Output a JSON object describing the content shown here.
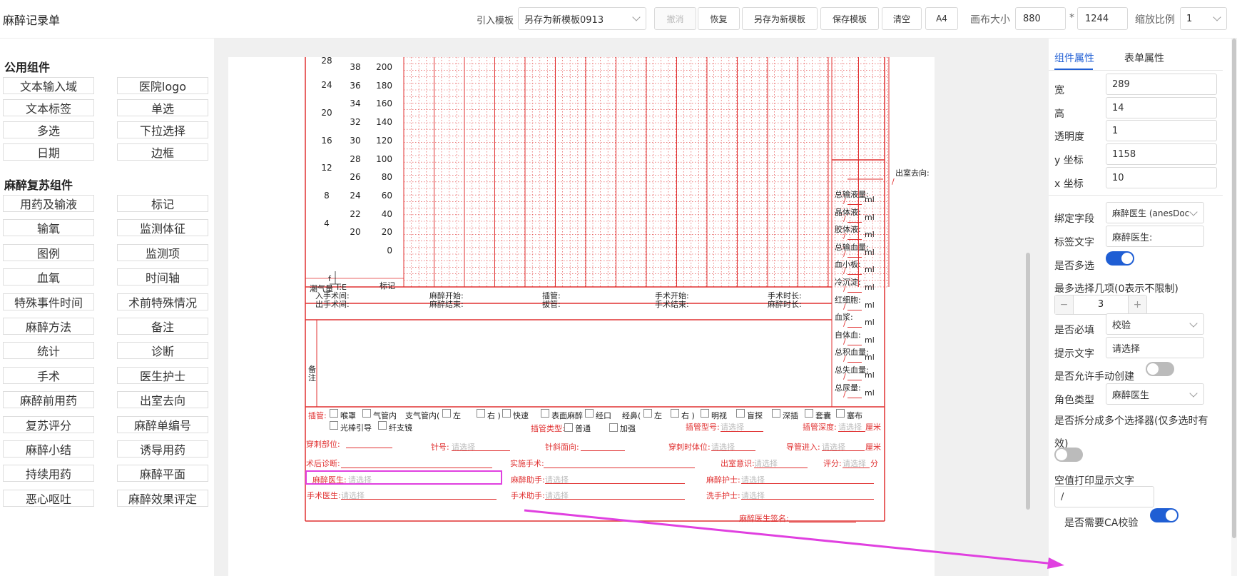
{
  "app": {
    "title": "麻醉记录单"
  },
  "toolbar": {
    "import_label": "引入模板",
    "template_value": "另存为新模板0913",
    "undo": "撤消",
    "redo": "恢复",
    "save_as_new": "另存为新模板",
    "save_template": "保存模板",
    "clear": "清空",
    "paper": "A4",
    "canvas_size_label": "画布大小",
    "canvas_w": "880",
    "times": "*",
    "canvas_h": "1244",
    "zoom_label": "缩放比例",
    "zoom_value": "1"
  },
  "left": {
    "common_title": "公用组件",
    "common": [
      "文本输入域",
      "医院logo",
      "文本标签",
      "单选",
      "多选",
      "下拉选择",
      "日期",
      "边框"
    ],
    "anes_title": "麻醉复苏组件",
    "anes": [
      "用药及输液",
      "标记",
      "输氧",
      "监测体征",
      "图例",
      "监测项",
      "血氧",
      "时间轴",
      "特殊事件时间",
      "术前特殊情况",
      "麻醉方法",
      "备注",
      "统计",
      "诊断",
      "手术",
      "医生护士",
      "麻醉前用药",
      "出室去向",
      "复苏评分",
      "麻醉单编号",
      "麻醉小结",
      "诱导用药",
      "持续用药",
      "麻醉平面",
      "恶心呕吐",
      "麻醉效果评定"
    ]
  },
  "chart": {
    "col1": [
      "28",
      "24",
      "20",
      "16",
      "12",
      "8",
      "4"
    ],
    "col2": [
      "38",
      "36",
      "34",
      "32",
      "30",
      "28",
      "26",
      "24",
      "22",
      "20"
    ],
    "col3": [
      "200",
      "180",
      "160",
      "140",
      "120",
      "100",
      "80",
      "60",
      "40",
      "20",
      "0"
    ],
    "f_label": "f",
    "tide_label": "潮气量",
    "ie_label": "I:E",
    "mark_label": "标记"
  },
  "times": {
    "in_op": "入手术间:",
    "out_op": "出手术间:",
    "anes_start": "麻醉开始:",
    "anes_end": "麻醉结束:",
    "intub": "插管:",
    "extub": "拔管:",
    "op_start": "手术开始:",
    "op_end": "手术结束:",
    "op_dur": "手术时长:",
    "anes_dur": "麻醉时长:"
  },
  "remarks": {
    "label": "备注"
  },
  "side_stats": {
    "exit_dest": "出室去向:",
    "slash": "/",
    "ml": "ml",
    "items": [
      "总输液量:",
      "晶体液:",
      "胶体液:",
      "总输血量:",
      "血小板:",
      "冷沉淀:",
      "红细胞:",
      "血浆:",
      "自体血:",
      "总积血量:",
      "总失血量:",
      "总尿量:"
    ]
  },
  "intubation": {
    "label": "插管:",
    "opts": [
      "喉罩",
      "气管内",
      "支气管内(",
      "左",
      "右 )",
      "快速",
      "表面麻醉",
      "经口",
      "经鼻(",
      "左",
      "右 )",
      "明视",
      "盲探",
      "深插",
      "套囊",
      "塞布"
    ],
    "opts2": [
      "光棒引导",
      "纤支镜"
    ],
    "type_label": "插管类型:",
    "type_opts": [
      "普通",
      "加强"
    ],
    "model_label": "插管型号:",
    "depth_label": "插管深度:",
    "cm": "厘米",
    "placeholder": "请选择"
  },
  "puncture": {
    "site": "穿刺部位:",
    "needle": "针号:",
    "bevel": "针斜面向:",
    "position": "穿刺时体位:",
    "catheter": "导管进入:",
    "cm": "厘米"
  },
  "diag": {
    "post_diag": "术后诊断:",
    "actual_op": "实施手术:",
    "exit_consc": "出室意识:",
    "score": "评分:",
    "score_unit": "分"
  },
  "staff": {
    "anes_doc": "麻醉医生:",
    "anes_asst": "麻醉助手:",
    "anes_nurse": "麻醉护士:",
    "surgeon": "手术医生:",
    "op_asst": "手术助手:",
    "scrub_nurse": "洗手护士:",
    "signature": "麻醉医生签名:",
    "placeholder": "请选择"
  },
  "right": {
    "tab_component": "组件属性",
    "tab_form": "表单属性",
    "width_label": "宽",
    "width": "289",
    "height_label": "高",
    "height": "14",
    "opacity_label": "透明度",
    "opacity": "1",
    "y_label": "y 坐标",
    "y": "1158",
    "x_label": "x 坐标",
    "x": "10",
    "bind_label": "绑定字段",
    "bind_value": "麻醉医生 (anesDoc",
    "label_text_label": "标签文字",
    "label_text": "麻醉医生:",
    "multi_label": "是否多选",
    "max_label": "最多选择几项(0表示不限制)",
    "max_value": "3",
    "minus": "−",
    "plus": "+",
    "required_label": "是否必填",
    "required_value": "校验",
    "hint_label": "提示文字",
    "hint_value": "请选择",
    "manual_label": "是否允许手动创建",
    "role_label": "角色类型",
    "role_value": "麻醉医生",
    "split_label": "是否拆分成多个选择器(仅多选时有效)",
    "empty_print_label": "空值打印显示文字",
    "empty_print_value": "/",
    "ca_label": "是否需要CA校验"
  },
  "colors": {
    "accent": "#1f5ed4",
    "grid_red": "#e03030",
    "highlight": "#e040e0"
  }
}
